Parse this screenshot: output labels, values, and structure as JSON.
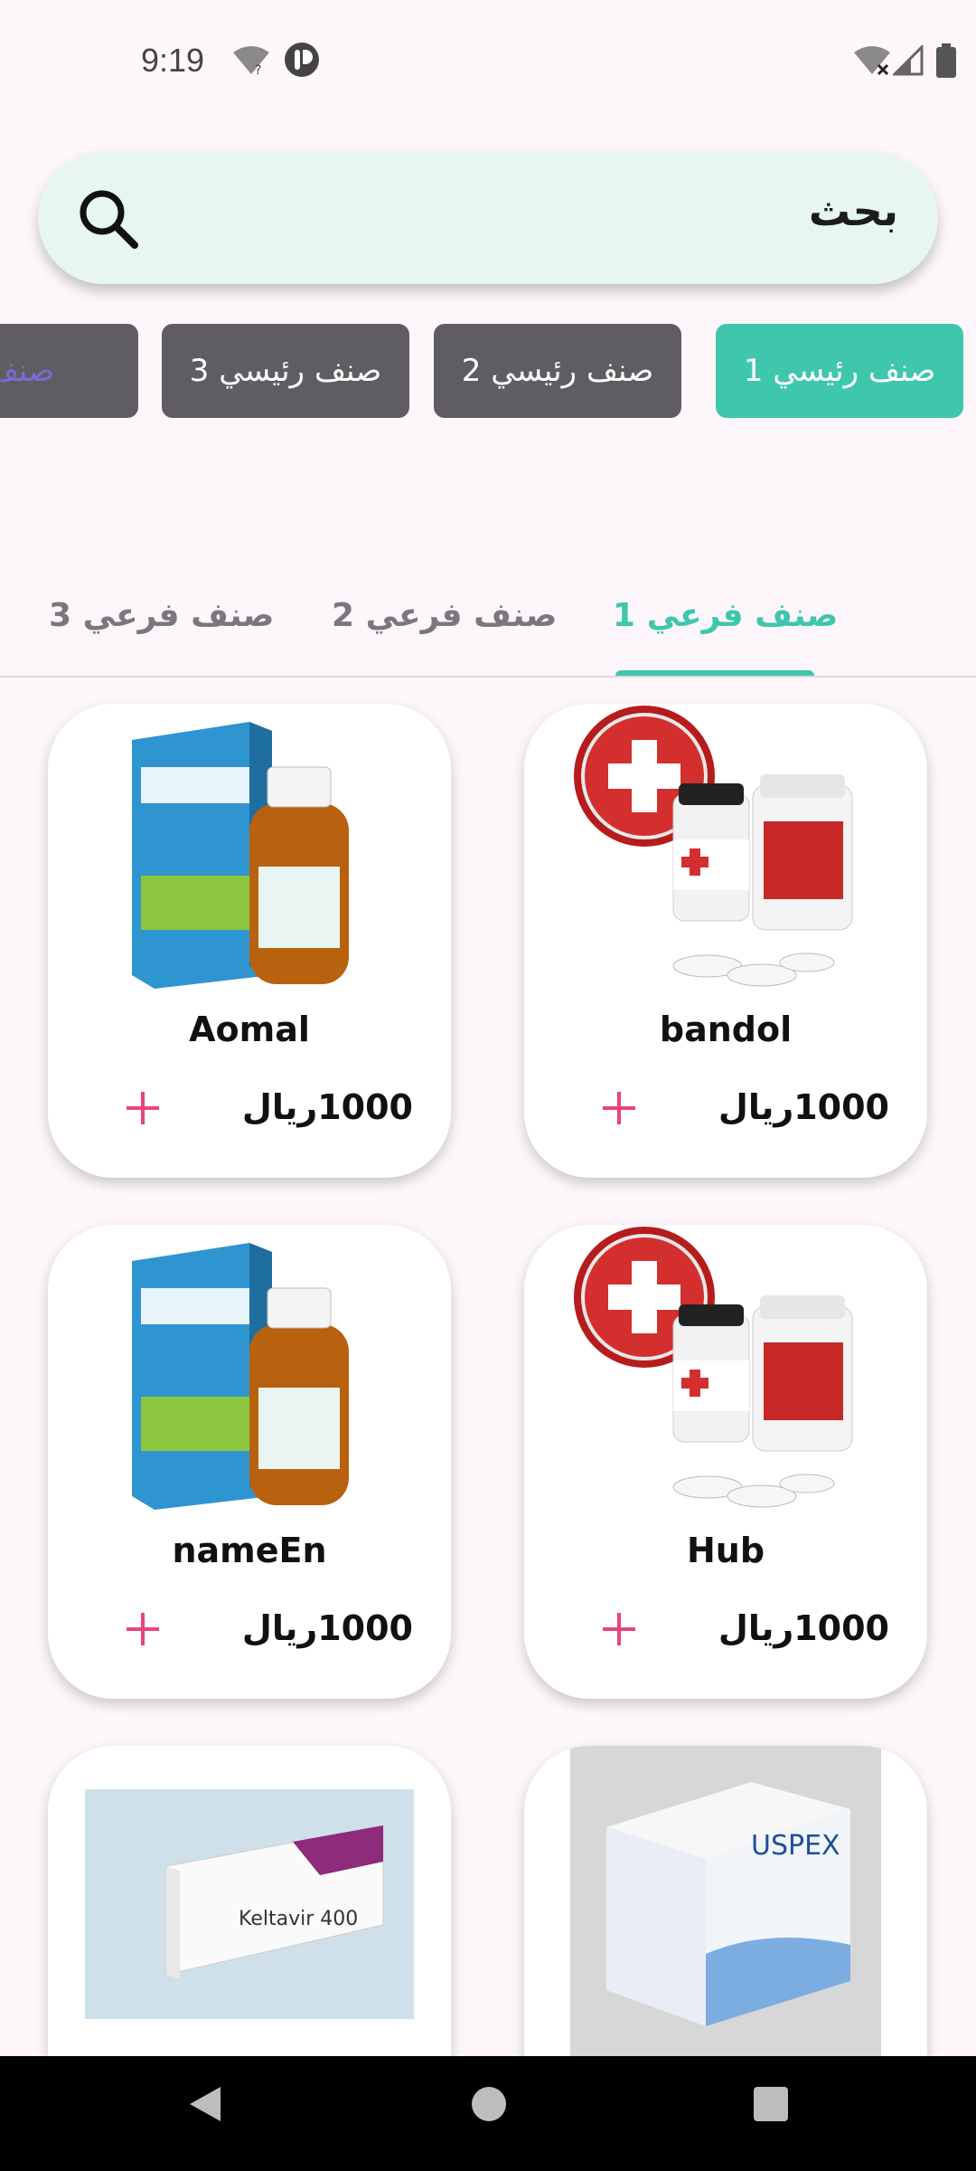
{
  "status_bar": {
    "time": "9:19",
    "icons": [
      "wifi-question-icon",
      "vpn-icon",
      "wifi-off-icon",
      "signal-icon",
      "battery-icon"
    ]
  },
  "search": {
    "placeholder": "بحث",
    "icon": "search-icon"
  },
  "main_categories": [
    {
      "label": "صنف رئيسي 1",
      "active": true
    },
    {
      "label": "صنف رئيسي 2",
      "active": false
    },
    {
      "label": "صنف رئيسي 3",
      "active": false
    },
    {
      "label": "صنف رئيسي",
      "active": false
    }
  ],
  "sub_categories": [
    {
      "label": "صنف فرعي 1",
      "active": true
    },
    {
      "label": "صنف فرعي 2",
      "active": false
    },
    {
      "label": "صنف فرعي 3",
      "active": false
    }
  ],
  "products": [
    {
      "name": "bandol",
      "price": "1000ريال",
      "image": "medicine-pills-image"
    },
    {
      "name": "Aomal",
      "price": "1000ريال",
      "image": "syrup-box-image"
    },
    {
      "name": "Hub",
      "price": "1000ريال",
      "image": "medicine-pills-image"
    },
    {
      "name": "nameEn",
      "price": "1000ريال",
      "image": "syrup-box-image"
    },
    {
      "name": "",
      "price": "",
      "image": "uspex-box-image",
      "box_text": "USPEX"
    },
    {
      "name": "",
      "price": "",
      "image": "keltavir-box-image",
      "box_text": "Keltavir 400"
    }
  ],
  "colors": {
    "accent": "#3ec7ac",
    "chip_inactive": "#5f5d62",
    "add_icon": "#e8457c",
    "search_bg": "#e7f5f3",
    "page_bg": "#fdf7fb"
  },
  "nav_bar": {
    "buttons": [
      "back-icon",
      "home-icon",
      "recents-icon"
    ]
  }
}
